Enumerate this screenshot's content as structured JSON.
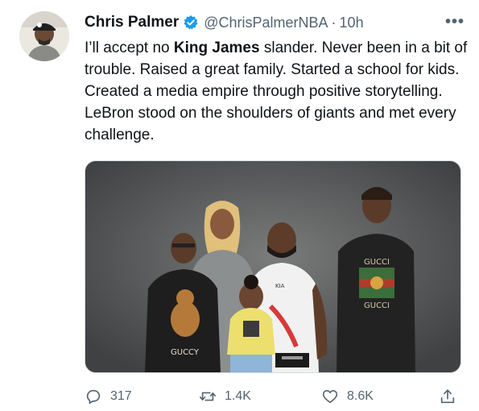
{
  "tweet": {
    "author_name": "Chris Palmer",
    "handle": "@ChrisPalmerNBA",
    "separator": "·",
    "time": "10h",
    "more_label": "•••",
    "text_before": "I’ll accept no ",
    "text_bold": "King James",
    "text_after": " slander. Never been in a bit of trouble. Raised a great family. Started a school for kids. Created a media empire through positive storytelling. LeBron stood on the shoulders of giants and met every challenge.",
    "photo": {
      "shirt_left_text": "GUCCY",
      "shirt_right_top": "GUCCI",
      "shirt_right_bottom": "GUCCI",
      "shirt_center_logo": "KIA"
    }
  },
  "actions": {
    "replies": "317",
    "retweets": "1.4K",
    "likes": "8.6K"
  },
  "colors": {
    "text_primary": "#0f1419",
    "text_secondary": "#536471",
    "verified": "#1d9bf0"
  },
  "icons": {
    "verified": "verified-badge-icon",
    "more": "more-options-icon",
    "reply": "reply-icon",
    "retweet": "retweet-icon",
    "like": "heart-icon",
    "share": "share-icon"
  }
}
